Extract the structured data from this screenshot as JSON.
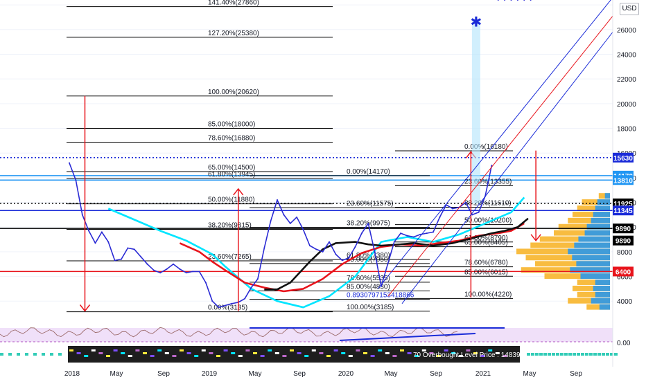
{
  "currency": "USD",
  "colors": {
    "up": "#26a69a",
    "down": "#ef5350",
    "price": "#2a2ad4",
    "fib": "#000000",
    "arrow": "#e8141c",
    "target": "#1a2bd8",
    "volume": "#f7b52b",
    "volume_alt": "#2196f3",
    "rsi_band": "#e6ccf5",
    "osc_band": "#1e1e1e"
  },
  "chart_data": {
    "type": "line",
    "title": "",
    "x_ticks": [
      "2018",
      "May",
      "Sep",
      "2019",
      "May",
      "Sep",
      "2020",
      "May",
      "Sep",
      "2021",
      "May",
      "Sep"
    ],
    "y_ticks": [
      4000,
      6000,
      8000,
      10000,
      12000,
      14000,
      16000,
      18000,
      20000,
      22000,
      24000,
      26000,
      28000
    ],
    "y_tick_labels": [
      "4000",
      "6000",
      "8000",
      "10000",
      "12000",
      "14000",
      "16000",
      "18000",
      "20000",
      "22000",
      "24000",
      "26000",
      "28000"
    ],
    "ylim": [
      2500,
      28400
    ],
    "price_labels": [
      {
        "text": "15630",
        "value": 15630,
        "bg": "#1a2bd8",
        "fg": "#ffffff"
      },
      {
        "text": "14170",
        "value": 14170,
        "bg": "#2196f3",
        "fg": "#ffffff"
      },
      {
        "text": "13810",
        "value": 13810,
        "bg": "#2196f3",
        "fg": "#ffffff"
      },
      {
        "text": "11925",
        "value": 11925,
        "bg": "#000000",
        "fg": "#ffffff"
      },
      {
        "text": "11345",
        "value": 11345,
        "bg": "#1a2bd8",
        "fg": "#ffffff"
      },
      {
        "text": "9890",
        "value": 9890,
        "bg": "#000000",
        "fg": "#ffffff"
      },
      {
        "text": "9890",
        "value": 8910,
        "bg": "#000000",
        "fg": "#ffffff"
      },
      {
        "text": "6400",
        "value": 6400,
        "bg": "#e8141c",
        "fg": "#ffffff"
      }
    ],
    "fib_levels": [
      {
        "label": "141.40%(27860)",
        "value": 27860
      },
      {
        "label": "127.20%(25380)",
        "value": 25380
      },
      {
        "label": "100.00%(20620)",
        "value": 20620
      },
      {
        "label": "85.00%(18000)",
        "value": 18000
      },
      {
        "label": "78.60%(16880)",
        "value": 16880
      },
      {
        "label": "65.00%(14500)",
        "value": 14500
      },
      {
        "label": "61.80%(13945)",
        "value": 13945
      },
      {
        "label": "50.00%(11880)",
        "value": 11880
      },
      {
        "label": "38.20%(9815)",
        "value": 9815
      },
      {
        "label": "23.60%(7265)",
        "value": 7265
      },
      {
        "label": "0.00%(3135)",
        "value": 3135
      },
      {
        "label": "0.00%(14170)",
        "value": 14170
      },
      {
        "label": "23.60%(11575)",
        "value": 11575
      },
      {
        "label": "38.20%(9975)",
        "value": 9975
      },
      {
        "label": "61.80%(7380)",
        "value": 7380
      },
      {
        "label": "65.00%(7050)",
        "value": 7050
      },
      {
        "label": "78.60%(5535)",
        "value": 5535
      },
      {
        "label": "85.00%(4830)",
        "value": 4830
      },
      {
        "label": "0.8930797153418866",
        "value": 4150
      },
      {
        "label": "100.00%(3185)",
        "value": 3185
      },
      {
        "label": "0.00%(16180)",
        "value": 16180
      },
      {
        "label": "23.60%(13355)",
        "value": 13355
      },
      {
        "label": "38.20%(11610)",
        "value": 11610
      },
      {
        "label": "50.00%(10200)",
        "value": 10200
      },
      {
        "label": "61.80%(8790)",
        "value": 8790
      },
      {
        "label": "65.00%(8405)",
        "value": 8405
      },
      {
        "label": "78.60%(6780)",
        "value": 6780
      },
      {
        "label": "85.00%(6015)",
        "value": 6015
      },
      {
        "label": "100.00%(4220)",
        "value": 4220
      }
    ],
    "horizontal_lines": [
      {
        "value": 15630,
        "style": "dotted",
        "color": "#1a2bd8"
      },
      {
        "value": 14170,
        "style": "solid",
        "color": "#2196f3"
      },
      {
        "value": 13810,
        "style": "solid",
        "color": "#2196f3"
      },
      {
        "value": 11925,
        "style": "dotted",
        "color": "#000000"
      },
      {
        "value": 11345,
        "style": "solid",
        "color": "#1a2bd8"
      },
      {
        "value": 9890,
        "style": "solid",
        "color": "#000000"
      },
      {
        "value": 6400,
        "style": "solid",
        "color": "#e8141c"
      }
    ],
    "price_series": {
      "name": "",
      "x": [
        0.0,
        0.5,
        1.0,
        1.5,
        2.0,
        2.5,
        3.0,
        3.5,
        4.0,
        4.5,
        5.0,
        5.5,
        6.0,
        6.5,
        7.0,
        7.5,
        8.0,
        8.5,
        9.0,
        9.5,
        10.0,
        10.5,
        11.0,
        11.5,
        12.0,
        12.5,
        13.0,
        13.5,
        14.0,
        14.5,
        15.0,
        15.5,
        16.0,
        16.5,
        17.0,
        17.5,
        18.0,
        18.5,
        19.0,
        19.5,
        20.0,
        20.5,
        21.0,
        21.5,
        22.0,
        22.5,
        23.0,
        23.5,
        24.0,
        24.5,
        25.0,
        25.5,
        26.0,
        26.5,
        27.0,
        27.5,
        28.0,
        28.5,
        29.0,
        29.5,
        30.0,
        30.5,
        31.0,
        31.5,
        32.0,
        32.5,
        33.0,
        33.5,
        34.0,
        34.5,
        35.0,
        35.5
      ],
      "y": [
        15200,
        13800,
        11000,
        9700,
        8700,
        9600,
        8800,
        7300,
        7400,
        8300,
        8200,
        7600,
        7000,
        6500,
        6300,
        6600,
        7000,
        6600,
        6300,
        6400,
        6400,
        5500,
        4000,
        3500,
        3650,
        3800,
        3900,
        4200,
        5100,
        5800,
        8300,
        10500,
        12200,
        11000,
        10300,
        10800,
        9800,
        8500,
        8200,
        8000,
        8800,
        7800,
        7300,
        7500,
        8400,
        9500,
        10300,
        8000,
        5200,
        7000,
        8800,
        9500,
        9300,
        9200,
        9400,
        9500,
        9600,
        10800,
        11800,
        11500,
        11600,
        12000,
        11000,
        11200,
        12500,
        15000
      ],
      "color": "#2a2ad4"
    },
    "ema_series": [
      {
        "name": "",
        "color": "#00e5ff",
        "x": [
          3,
          5,
          7,
          9,
          11,
          12,
          14,
          16,
          18,
          20,
          22,
          24,
          26,
          28,
          30,
          32,
          34,
          35
        ],
        "y": [
          11500,
          10600,
          9700,
          8900,
          7800,
          6800,
          5000,
          4000,
          3500,
          4400,
          6000,
          8800,
          9200,
          8800,
          9400,
          10300,
          11200,
          12400
        ]
      },
      {
        "name": "",
        "color": "#e8141c",
        "x": [
          8.5,
          10,
          11,
          12,
          13.5,
          15,
          16.5,
          18,
          19.5,
          21,
          22.5,
          24,
          25.5,
          27,
          28.5,
          30,
          31.5,
          33,
          34,
          35
        ],
        "y": [
          8700,
          8000,
          7200,
          6500,
          5500,
          5100,
          4800,
          5000,
          5800,
          7000,
          7900,
          8400,
          8600,
          8500,
          8700,
          8900,
          9300,
          9500,
          9700,
          10300
        ]
      },
      {
        "name": "",
        "color": "#111111",
        "x": [
          15,
          16,
          17,
          18.5,
          19.5,
          20.5,
          22,
          23,
          24,
          25.5,
          26.5,
          28,
          29.5,
          31,
          32.5,
          33.5,
          34.5,
          35.3
        ],
        "y": [
          4950,
          4950,
          5500,
          7200,
          8200,
          8700,
          8800,
          8600,
          8500,
          8600,
          8700,
          8500,
          8700,
          9100,
          9500,
          9700,
          10000,
          10700
        ]
      }
    ],
    "volume_profile": {
      "type": "bar",
      "orientation": "horizontal",
      "bins": [
        3500,
        4000,
        4500,
        5000,
        5500,
        6000,
        6500,
        7000,
        7500,
        8000,
        8500,
        9000,
        9500,
        10000,
        10500,
        11000,
        11500,
        12000,
        12500
      ],
      "values": [
        0.25,
        0.45,
        0.35,
        0.4,
        0.35,
        0.7,
        0.95,
        0.8,
        0.9,
        1.0,
        0.85,
        0.75,
        0.6,
        0.55,
        0.45,
        0.4,
        0.35,
        0.3,
        0.12
      ]
    },
    "arrows": [
      {
        "x": 1.2,
        "from": 20620,
        "to": 3200,
        "color": "#e8141c"
      },
      {
        "x": 13.0,
        "from": 3200,
        "to": 13100,
        "color": "#e8141c"
      },
      {
        "x": 30.9,
        "from": 4300,
        "to": 16100,
        "color": "#e8141c"
      },
      {
        "x": 35.9,
        "from": 16200,
        "to": 8900,
        "color": "#e8141c"
      }
    ],
    "target_marker": {
      "x": 31.3,
      "value": 26700,
      "symbol": "✱",
      "color": "#1a2bd8"
    },
    "rsi_panel": {
      "band": [
        30,
        70
      ],
      "level_label": ""
    },
    "oscillator_panel": {
      "label": "70 Overbought Level Price : 14839.2"
    },
    "lower_axis_label": "0.00"
  }
}
